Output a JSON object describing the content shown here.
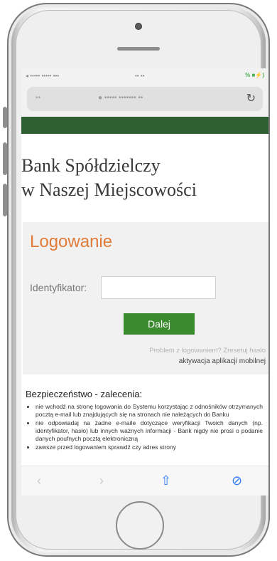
{
  "status_bar": {
    "left": "◂ ••••• ••••• •••",
    "center": "•• ••",
    "right": "% ■⚡)"
  },
  "address_bar": {
    "left_text": "••",
    "url": "● ••••• ••••••• ••",
    "reload_glyph": "↻"
  },
  "bank": {
    "line1": "Bank Spółdzielczy",
    "line2": "w Naszej Miejscowości"
  },
  "login": {
    "title": "Logowanie",
    "identifier_label": "Identyfikator:",
    "identifier_value": "",
    "button_label": "Dalej",
    "problem_text": "Problem z logowaniem? Zresetuj hasło",
    "activation_text": "aktywacja aplikacji mobilnej"
  },
  "security": {
    "title": "Bezpieczeństwo - zalecenia:",
    "items": [
      "nie wchodź na stronę logowania do Systemu korzystając z odnośników otrzymanych pocztą e-mail lub znajdujących się na stronach nie należących do Banku",
      "nie odpowiadaj na żadne e-maile dotyczące weryfikacji Twoich danych (np. identyfikator, hasło) lub innych ważnych informacji - Bank nigdy nie prosi o podanie danych poufnych pocztą elektroniczną",
      "zawsze przed logowaniem sprawdź czy adres strony"
    ]
  },
  "toolbar": {
    "back": "‹",
    "forward": "›",
    "share": "⇧",
    "compass": "⊘"
  },
  "colors": {
    "header_green": "#2d5f33",
    "title_orange": "#e07b39",
    "button_green": "#3a8a2e",
    "ios_blue": "#2f7cf6"
  }
}
